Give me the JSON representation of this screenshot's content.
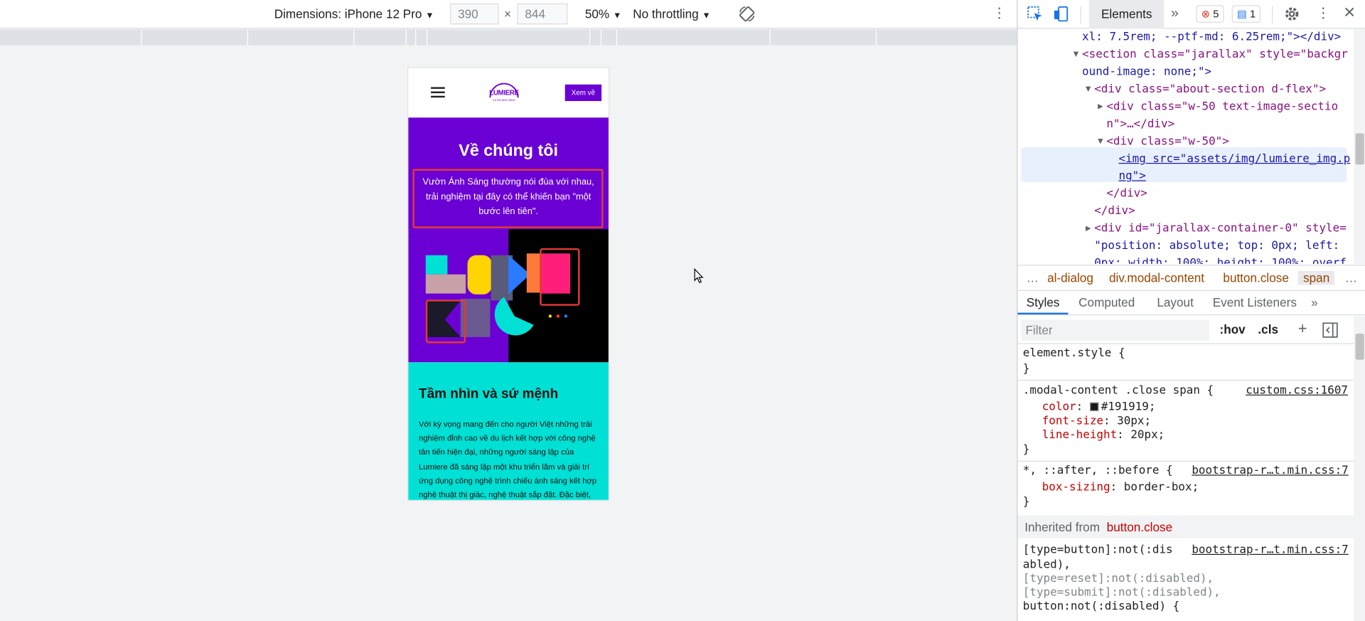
{
  "device_toolbar": {
    "dimensions_label": "Dimensions: iPhone 12 Pro",
    "width": "390",
    "times": "×",
    "height": "844",
    "zoom": "50%",
    "throttling": "No throttling"
  },
  "page": {
    "header": {
      "logo_text": "LUMIERE",
      "logo_sub": "VƯỜN ÁNH SÁNG",
      "cta": "Xem về"
    },
    "hero": {
      "title": "Về chúng tôi",
      "text": "Vườn Ánh Sáng thường nói đùa với nhau, trải nghiệm tại đây có thể khiến bạn \"một bước lên tiên\"."
    },
    "mission": {
      "title": "Tầm nhìn và sứ mệnh",
      "text": "Với kỳ vọng mang đến cho người Việt những trải nghiệm đỉnh cao về du lịch kết hợp với công nghệ tân tiến hiện đại, những người sáng lập của Lumiere đã sáng lập một khu triển lãm và giải trí ứng dụng công nghệ trình chiếu ánh sáng kết hợp nghệ thuật thị giác, nghệ thuật sắp đặt. Đặc biệt,"
    }
  },
  "devtools": {
    "tabs": {
      "active": "Elements",
      "more": "»",
      "errors": "5",
      "messages": "1"
    },
    "dom": [
      "xl: 7.5rem; --ptf-md: 6.25rem;\"></div>",
      "<section class=\"jarallax\" style=\"backgr",
      "ound-image: none;\">",
      "<div class=\"about-section d-flex\">",
      "<div class=\"w-50 text-image-sectio",
      "n\">…</div>",
      "<div class=\"w-50\">",
      "<img src=\"assets/img/lumiere_img.p",
      "ng\">",
      "</div>",
      "</div>",
      "<div id=\"jarallax-container-0\" style=",
      "\"position: absolute; top: 0px; left:",
      "0px; width: 100%; height: 100%; overf"
    ],
    "breadcrumbs": [
      "…",
      "al-dialog",
      "div.modal-content",
      "button.close",
      "span",
      "…"
    ],
    "sub_tabs": [
      "Styles",
      "Computed",
      "Layout",
      "Event Listeners",
      "»"
    ],
    "filter_placeholder": "Filter",
    "filter_buttons": [
      ":hov",
      ".cls",
      "+"
    ],
    "styles": {
      "element_style": "element.style {",
      "close_brace": "}",
      "rule1_selector": ".modal-content .close span {",
      "rule1_source": "custom.css:1607",
      "rule1_props": [
        {
          "name": "color",
          "value": "#191919;"
        },
        {
          "name": "font-size",
          "value": "30px;"
        },
        {
          "name": "line-height",
          "value": "20px;"
        }
      ],
      "rule2_selector": "*, ::after, ::before {",
      "rule2_source": "bootstrap-r…t.min.css:7",
      "rule2_prop": {
        "name": "box-sizing",
        "value": "border-box;"
      },
      "inherited_label": "Inherited from",
      "inherited_from": "button.close",
      "rule3_source": "bootstrap-r…t.min.css:7",
      "rule3_lines": [
        "[type=button]:not(:dis",
        "abled),",
        "[type=reset]:not(:disabled),",
        "[type=submit]:not(:disabled),",
        "button:not(:disabled) {"
      ]
    }
  }
}
